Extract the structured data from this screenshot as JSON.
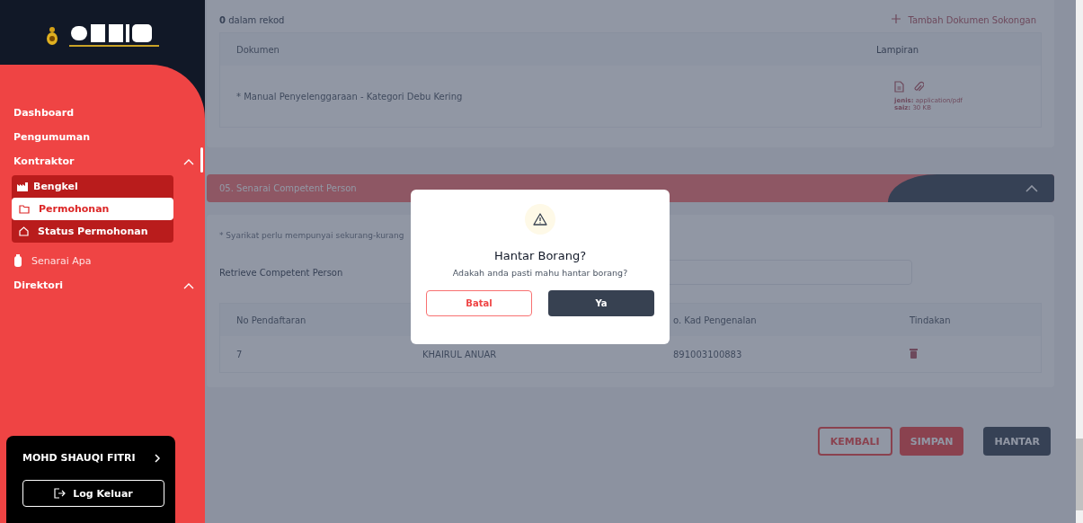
{
  "sidebar": {
    "nav": [
      {
        "kind": "link",
        "label": "Dashboard"
      },
      {
        "kind": "link",
        "label": "Pengumuman"
      },
      {
        "kind": "group",
        "label": "Kontraktor",
        "expanded": true,
        "children": [
          {
            "kind": "header",
            "label": "Bengkel"
          },
          {
            "kind": "item",
            "label": "Permohonan",
            "selected": true
          },
          {
            "kind": "item",
            "label": "Status Permohonan",
            "selected": false
          }
        ]
      },
      {
        "kind": "muted",
        "label": "Senarai Apa"
      },
      {
        "kind": "group",
        "label": "Direktori",
        "expanded": true
      }
    ],
    "user": {
      "name": "MOHD SHAUQI FITRI",
      "logout": "Log Keluar"
    }
  },
  "documents": {
    "count": "0",
    "count_label": "dalam rekod",
    "add_link": "Tambah Dokumen Sokongan",
    "columns": [
      "Dokumen",
      "Lampiran"
    ],
    "rows": [
      {
        "document": "* Manual Penyelenggaraan - Kategori Debu Kering",
        "type_label": "jenis:",
        "type": "application/pdf",
        "size_label": "saiz:",
        "size": "30 KB"
      }
    ]
  },
  "competent": {
    "title": "05. Senarai Competent Person",
    "note": "* Syarikat perlu mempunyai sekurang-kurang",
    "retrieve_label": "Retrieve Competent Person",
    "columns": [
      "No Pendaftaran",
      "",
      "o. Kad Pengenalan",
      "Tindakan"
    ],
    "rows": [
      {
        "no": "7",
        "name": "KHAIRUL ANUAR",
        "ic": "891003100883"
      }
    ]
  },
  "actions": [
    {
      "kind": "outline",
      "label": "KEMBALI"
    },
    {
      "kind": "red",
      "label": "SIMPAN"
    },
    {
      "kind": "dark",
      "label": "HANTAR"
    }
  ],
  "dialog": {
    "title": "Hantar Borang?",
    "message": "Adakah anda pasti mahu hantar borang?",
    "buttons": [
      {
        "kind": "cancel",
        "label": "Batal"
      },
      {
        "kind": "confirm",
        "label": "Ya"
      }
    ]
  }
}
